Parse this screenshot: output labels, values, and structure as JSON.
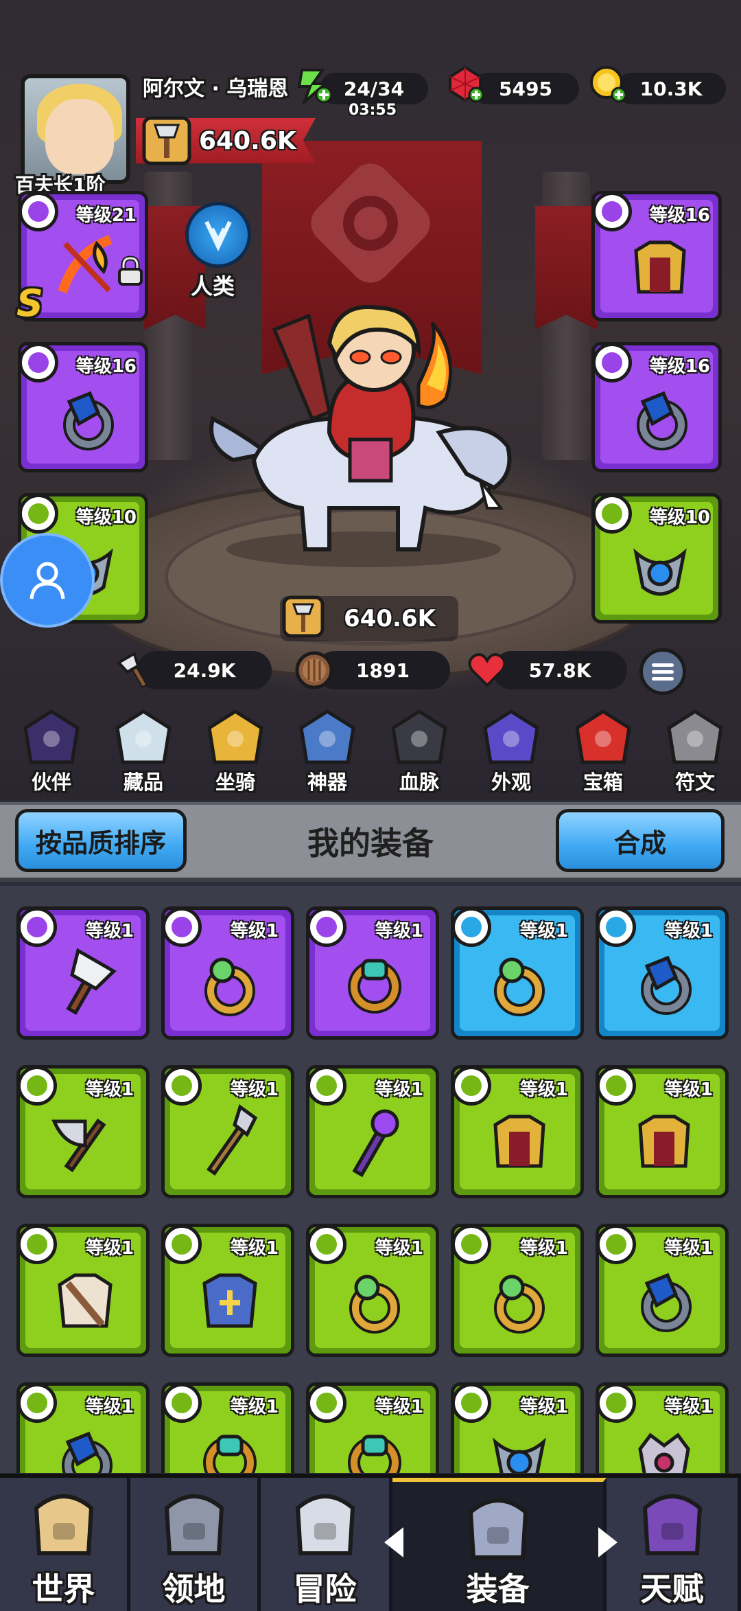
{
  "player": {
    "name": "阿尔文 · 乌瑞恩",
    "rank_title": "百夫长1阶",
    "power": "640.6K",
    "race": "人类",
    "rank_letter": "S"
  },
  "resources": {
    "energy": "24/34",
    "energy_timer": "03:55",
    "gems": "5495",
    "gold": "10.3K"
  },
  "equipped": {
    "left": [
      {
        "level": "等级21",
        "quality": "purple",
        "icon": "flame-bow-icon",
        "locked": true
      },
      {
        "level": "等级16",
        "quality": "purple",
        "icon": "sapphire-ring-icon"
      },
      {
        "level": "等级10",
        "quality": "green",
        "icon": "amulet-icon"
      }
    ],
    "right": [
      {
        "level": "等级16",
        "quality": "purple",
        "icon": "gold-armor-icon"
      },
      {
        "level": "等级16",
        "quality": "purple",
        "icon": "sapphire-ring-icon"
      },
      {
        "level": "等级10",
        "quality": "green",
        "icon": "amulet-icon"
      }
    ]
  },
  "stats": {
    "battle_power": "640.6K",
    "attack": "24.9K",
    "defense": "1891",
    "hp": "57.8K"
  },
  "features": [
    {
      "label": "伙伴",
      "icon": "companion-icon"
    },
    {
      "label": "藏品",
      "icon": "collection-icon"
    },
    {
      "label": "坐骑",
      "icon": "mount-icon"
    },
    {
      "label": "神器",
      "icon": "artifact-icon"
    },
    {
      "label": "血脉",
      "icon": "bloodline-icon"
    },
    {
      "label": "外观",
      "icon": "appearance-icon"
    },
    {
      "label": "宝箱",
      "icon": "chest-icon"
    },
    {
      "label": "符文",
      "icon": "rune-icon"
    }
  ],
  "inventory": {
    "title": "我的装备",
    "sort_label": "按品质排序",
    "merge_label": "合成",
    "items": [
      {
        "level": "等级1",
        "quality": "purple",
        "icon": "axe-icon"
      },
      {
        "level": "等级1",
        "quality": "purple",
        "icon": "emerald-ring-icon"
      },
      {
        "level": "等级1",
        "quality": "purple",
        "icon": "gold-ring-icon"
      },
      {
        "level": "等级1",
        "quality": "blue",
        "icon": "emerald-ring-icon"
      },
      {
        "level": "等级1",
        "quality": "blue",
        "icon": "sapphire-ring-icon"
      },
      {
        "level": "等级1",
        "quality": "green",
        "icon": "battle-axe-icon"
      },
      {
        "level": "等级1",
        "quality": "green",
        "icon": "spear-icon"
      },
      {
        "level": "等级1",
        "quality": "green",
        "icon": "staff-icon"
      },
      {
        "level": "等级1",
        "quality": "green",
        "icon": "gold-armor-icon"
      },
      {
        "level": "等级1",
        "quality": "green",
        "icon": "gold-armor-icon"
      },
      {
        "level": "等级1",
        "quality": "green",
        "icon": "leather-armor-icon"
      },
      {
        "level": "等级1",
        "quality": "green",
        "icon": "plate-armor-icon"
      },
      {
        "level": "等级1",
        "quality": "green",
        "icon": "emerald-ring-icon"
      },
      {
        "level": "等级1",
        "quality": "green",
        "icon": "emerald-ring-icon"
      },
      {
        "level": "等级1",
        "quality": "green",
        "icon": "sapphire-ring-icon"
      },
      {
        "level": "等级1",
        "quality": "green",
        "icon": "sapphire-ring-icon"
      },
      {
        "level": "等级1",
        "quality": "green",
        "icon": "gold-ring-icon"
      },
      {
        "level": "等级1",
        "quality": "green",
        "icon": "gold-ring-icon"
      },
      {
        "level": "等级1",
        "quality": "green",
        "icon": "amulet-icon"
      },
      {
        "level": "等级1",
        "quality": "green",
        "icon": "crown-amulet-icon"
      }
    ]
  },
  "nav": [
    {
      "label": "世界",
      "icon": "world-map-icon"
    },
    {
      "label": "领地",
      "icon": "castle-icon"
    },
    {
      "label": "冒险",
      "icon": "crossed-axes-icon"
    },
    {
      "label": "装备",
      "icon": "helmet-icon",
      "active": true
    },
    {
      "label": "天赋",
      "icon": "talent-book-icon"
    }
  ],
  "colors": {
    "purple": "#a34fef",
    "green": "#8fcf1e",
    "blue": "#39b8f1",
    "accent_red": "#d0303a",
    "button_blue": "#40a9f4"
  }
}
